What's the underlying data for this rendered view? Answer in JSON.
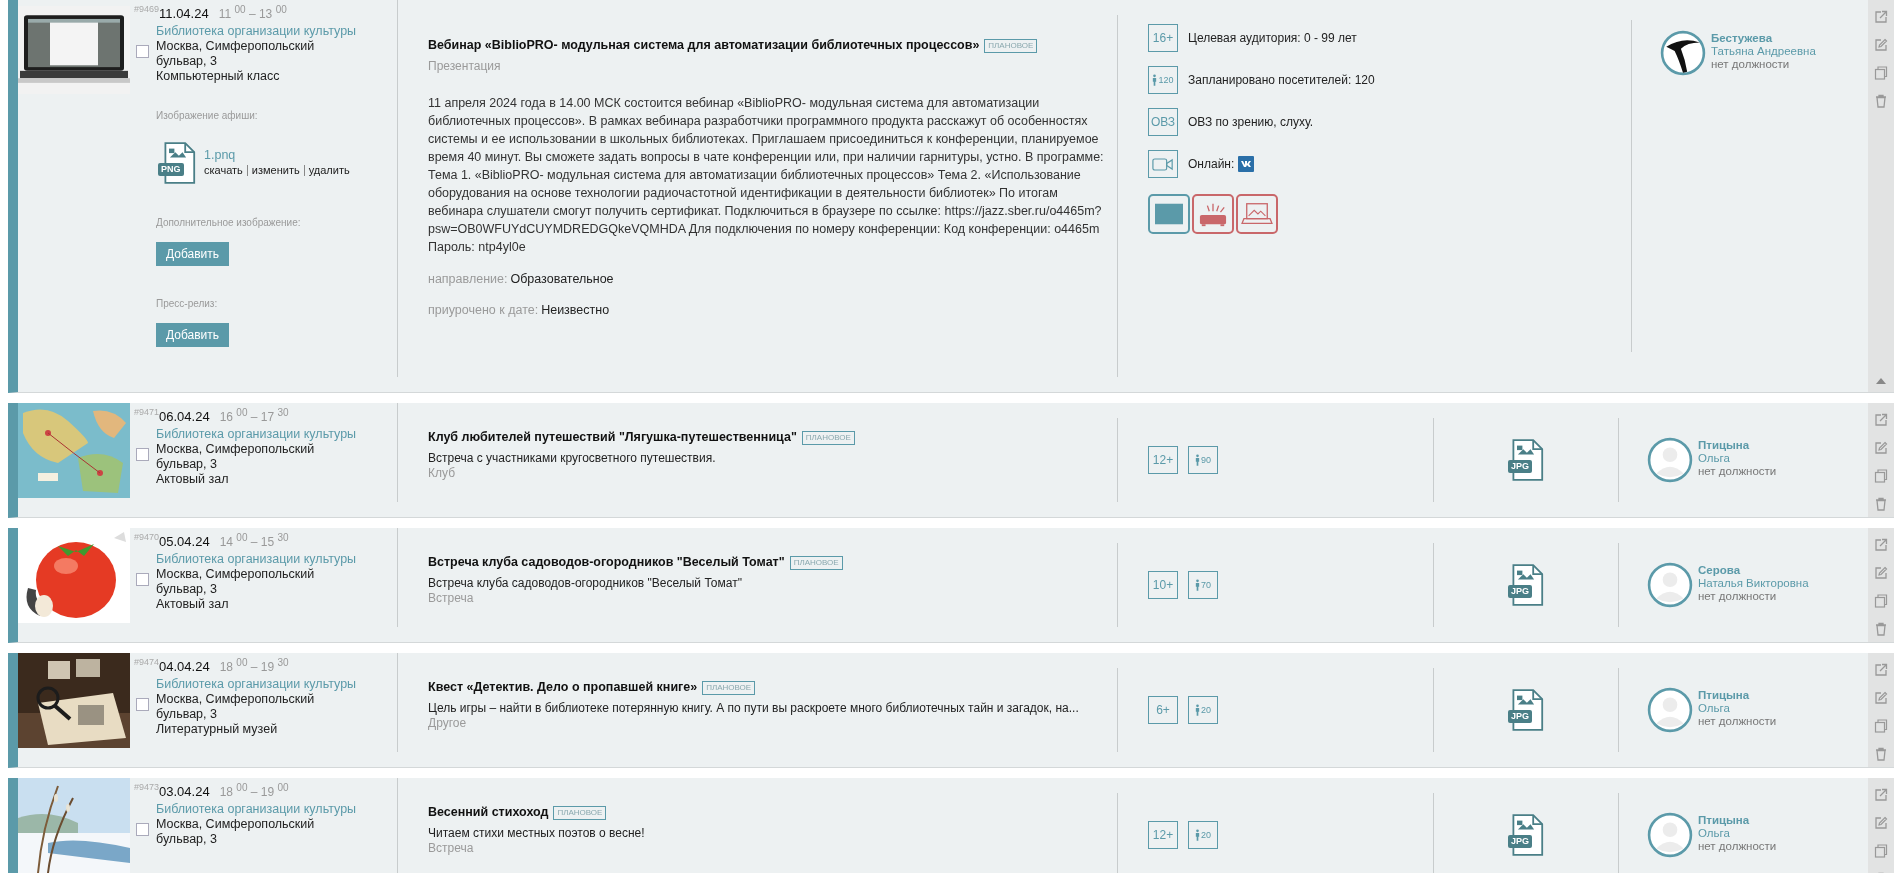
{
  "events": [
    {
      "number": "#9469",
      "date": "11.04.24",
      "time": "11 $^{00}$ – 13 $^{00}$",
      "checked": false,
      "expanded": true,
      "organization": "Библиотека организации культуры",
      "address": "Москва, Симферопольский бульвар, 3",
      "room": "Компьютерный класс",
      "poster": {
        "label": "Изображение афиши:",
        "file_type": "PNG",
        "file_name": "1.pnq",
        "actions": [
          "скачать",
          "изменить",
          "удалить"
        ]
      },
      "extra_image": {
        "label": "Дополнительное изображение:",
        "button": "Добавить"
      },
      "press_release": {
        "label": "Пресс-релиз:",
        "button": "Добавить"
      },
      "title": "Вебинар «BiblioPRO- модульная система для автоматизации библиотечных процессов»",
      "status": "ПЛАНОВОЕ",
      "format": "Презентация",
      "description": "11 апреля 2024 года в 14.00 МСК состоится вебинар «BiblioPRO- модульная система для автоматизации библиотечных процессов». В рамках вебинара разработчики программного продукта расскажут об особенностях системы и ее использовании в школьных библиотеках. Приглашаем присоединиться к конференции, планируемое время 40 минут. Вы сможете задать вопросы в чате конференции или, при наличии гарнитуры, устно. В программе: Тема 1. «BiblioPRO- модульная система для автоматизации библиотечных процессов» Тема 2. «Использование оборудования на основе технологии радиочастотной идентификации в деятельности библиотек» По итогам вебинара слушатели смогут получить сертификат. Подключиться в браузере по ссылке: https://jazz.sber.ru/o4465m?psw=OB0WFUYdCUYMDREDGQkeVQMHDA Для подключения по номеру конференции: Код конференции: o4465m Пароль: ntp4yl0e",
      "fields": [
        {
          "label": "направление:",
          "value": "Образовательное"
        },
        {
          "label": "приурочено к дате:",
          "value": "Неизвестно"
        }
      ],
      "attributes": [
        {
          "kind": "age",
          "badge": "16+",
          "text": "Целевая аудитория: 0 - 99 лет"
        },
        {
          "kind": "visitors",
          "badge": "120",
          "text": "Запланировано посетителей: 120"
        },
        {
          "kind": "ovz",
          "badge": "ОВЗ",
          "text": "ОВЗ по зрению, слуху."
        },
        {
          "kind": "online",
          "text": "Онлайн:"
        }
      ],
      "equipment": [
        {
          "kind": "screen",
          "color": "#5b9aa9"
        },
        {
          "kind": "projector",
          "color": "#c9676a"
        },
        {
          "kind": "laptop",
          "color": "#c9676a"
        }
      ],
      "person": {
        "surname": "Бестужева",
        "name": "Татьяна Андреевна",
        "position": "нет должности"
      }
    },
    {
      "number": "#9471",
      "date": "06.04.24",
      "time": "16 $^{00}$ – 17 $^{30}$",
      "checked": false,
      "expanded": false,
      "organization": "Библиотека организации культуры",
      "address": "Москва, Симферопольский бульвар, 3",
      "room": "Актовый зал",
      "title": "Клуб любителей путешествий \"Лягушка-путешественница\"",
      "status": "ПЛАНОВОЕ",
      "summary": "Встреча с участниками кругосветного путешествия.",
      "format": "Клуб",
      "age": "12+",
      "visitors": "90",
      "file_type": "JPG",
      "person": {
        "surname": "Птицына",
        "name": "Ольга",
        "position": "нет должности"
      }
    },
    {
      "number": "#9470",
      "date": "05.04.24",
      "time": "14 $^{00}$ – 15 $^{30}$",
      "checked": false,
      "expanded": false,
      "organization": "Библиотека организации культуры",
      "address": "Москва, Симферопольский бульвар, 3",
      "room": "Актовый зал",
      "title": "Встреча клуба садоводов-огородников \"Веселый Томат\"",
      "status": "ПЛАНОВОЕ",
      "summary": "Встреча клуба садоводов-огородников \"Веселый Томат\"",
      "format": "Встреча",
      "age": "10+",
      "visitors": "70",
      "file_type": "JPG",
      "person": {
        "surname": "Серова",
        "name": "Наталья Викторовна",
        "position": "нет должности"
      }
    },
    {
      "number": "#9474",
      "date": "04.04.24",
      "time": "18 $^{00}$ – 19 $^{30}$",
      "checked": false,
      "expanded": false,
      "organization": "Библиотека организации культуры",
      "address": "Москва, Симферопольский бульвар, 3",
      "room": "Литературный музей",
      "title": "Квест «Детектив. Дело о пропавшей книге»",
      "status": "ПЛАНОВОЕ",
      "summary": "Цель игры – найти в библиотеке потерянную книгу. А по пути вы раскроете много библиотечных тайн и загадок, на...",
      "format": "Другое",
      "age": "6+",
      "visitors": "20",
      "file_type": "JPG",
      "person": {
        "surname": "Птицына",
        "name": "Ольга",
        "position": "нет должности"
      }
    },
    {
      "number": "#9473",
      "date": "03.04.24",
      "time": "18 $^{00}$ – 19 $^{00}$",
      "checked": false,
      "expanded": false,
      "organization": "Библиотека организации культуры",
      "address": "Москва, Симферопольский бульвар, 3",
      "title": "Весенний стихоход",
      "status": "ПЛАНОВОЕ",
      "summary": "Читаем стихи местных поэтов о весне!",
      "format": "Встреча",
      "age": "12+",
      "visitors": "20",
      "file_type": "JPG",
      "person": {
        "surname": "Птицына",
        "name": "Ольга",
        "position": "нет должности"
      }
    }
  ]
}
